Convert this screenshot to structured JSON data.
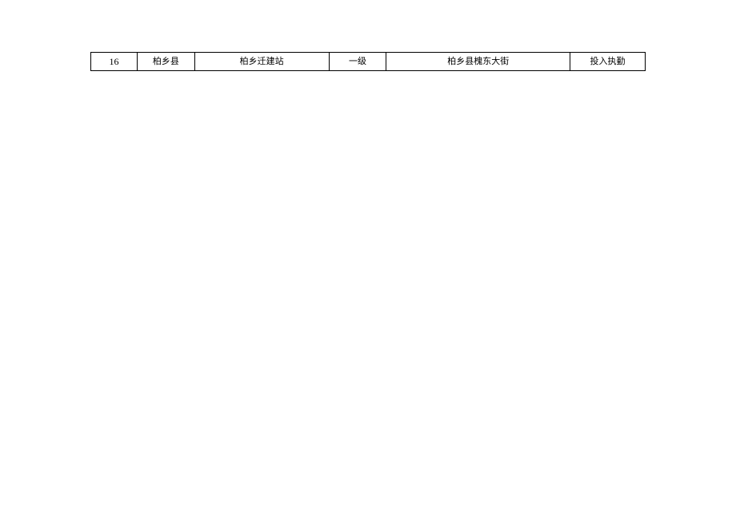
{
  "table": {
    "rows": [
      {
        "col1": "16",
        "col2": "柏乡县",
        "col3": "柏乡迁建站",
        "col4": "一级",
        "col5": "柏乡县槐东大街",
        "col6": "投入执勤"
      }
    ]
  }
}
